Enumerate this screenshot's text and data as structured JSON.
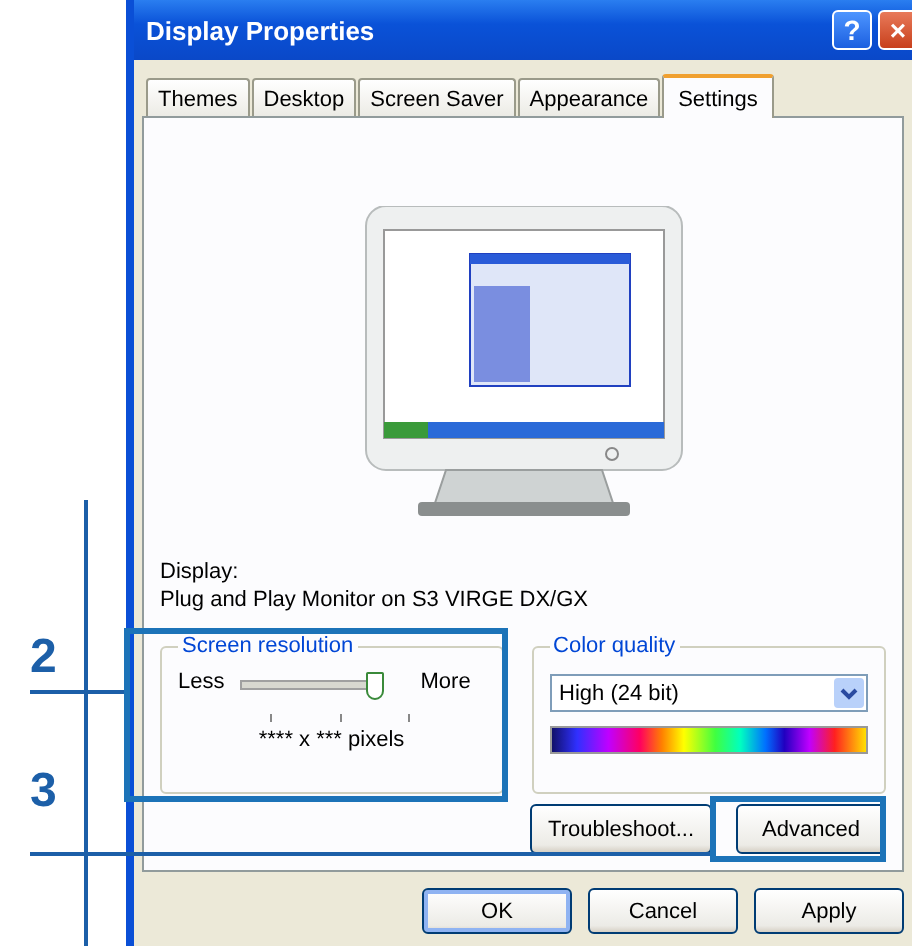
{
  "window": {
    "title": "Display Properties"
  },
  "title_buttons": [
    {
      "kind": "help",
      "label": "?"
    },
    {
      "kind": "close",
      "label": "×"
    }
  ],
  "tabs": [
    {
      "label": "Themes",
      "selected": false
    },
    {
      "label": "Desktop",
      "selected": false
    },
    {
      "label": "Screen Saver",
      "selected": false
    },
    {
      "label": "Appearance",
      "selected": false
    },
    {
      "label": "Settings",
      "selected": true
    }
  ],
  "display": {
    "label": "Display:",
    "device": "Plug and Play Monitor on S3 VIRGE DX/GX"
  },
  "screen_resolution": {
    "title": "Screen resolution",
    "min_label": "Less",
    "max_label": "More",
    "level": 1,
    "reading": "**** x *** pixels"
  },
  "color_quality": {
    "title": "Color quality",
    "value": "High (24 bit)"
  },
  "panel_buttons": [
    "Troubleshoot...",
    "Advanced"
  ],
  "dialog_buttons": [
    {
      "label": "OK",
      "default": true
    },
    {
      "label": "Cancel",
      "default": false
    },
    {
      "label": "Apply",
      "default": false
    }
  ],
  "callouts": [
    {
      "label": "2"
    },
    {
      "label": "3"
    }
  ]
}
